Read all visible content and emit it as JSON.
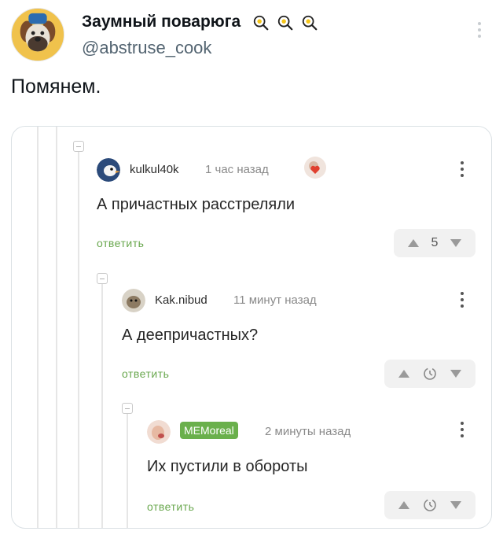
{
  "tweet": {
    "display_name": "Заумный поварюга",
    "handle": "@abstruse_cook",
    "text": "Помянем.",
    "badge_icon": "frying-pan-icon"
  },
  "screenshot": {
    "comments": [
      {
        "author": "kulkul40k",
        "time": "1 час назад",
        "text": "А причастных расстреляли",
        "reply_label": "ответить",
        "rating": "5"
      },
      {
        "author": "Kak.nibud",
        "time": "11 минут назад",
        "text": "А деепричастных?",
        "reply_label": "ответить",
        "rating": "pending"
      },
      {
        "author": "MEMoreal",
        "time": "2 минуты назад",
        "text": "Их пустили в обороты",
        "reply_label": "ответить",
        "rating": "pending"
      }
    ],
    "colors": {
      "reply_green": "#6aa84f",
      "author_badge": "#6ab04c"
    }
  }
}
